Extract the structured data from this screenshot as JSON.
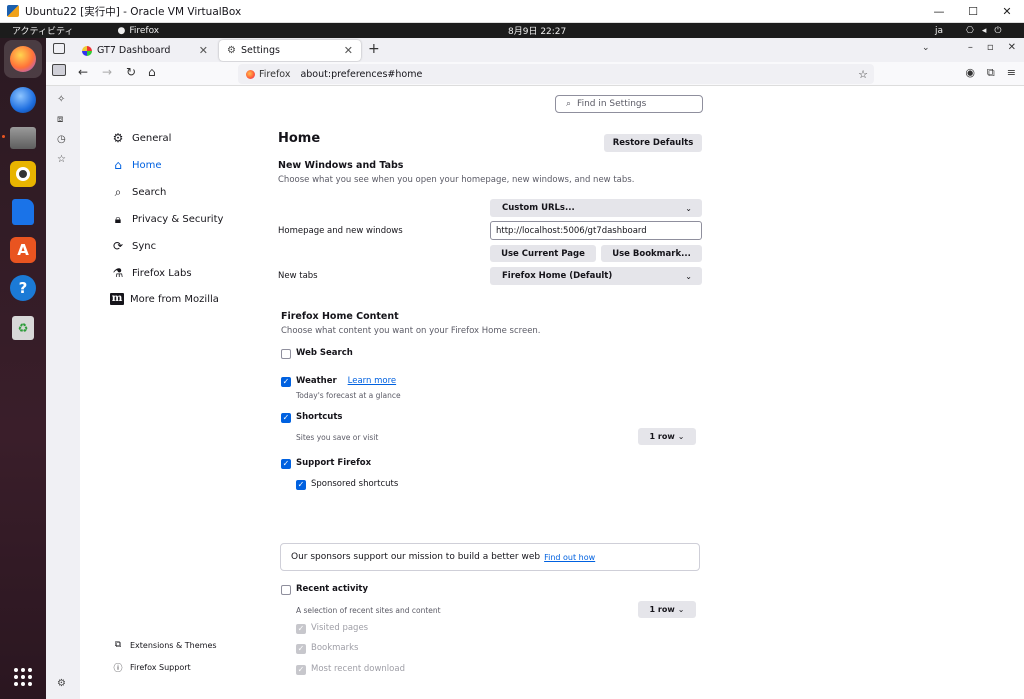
{
  "host_window": {
    "title": "Ubuntu22 [実行中] - Oracle VM VirtualBox",
    "controls": [
      "—",
      "☐",
      "✕"
    ]
  },
  "gnome": {
    "activities": "アクティビティ",
    "app_name": "Firefox",
    "clock": "8月9日  22:27",
    "lang": "ja"
  },
  "tabs": [
    {
      "label": "GT7 Dashboard",
      "active": false
    },
    {
      "label": "Settings",
      "active": true
    }
  ],
  "url": {
    "identity": "Firefox",
    "address": "about:preferences#home"
  },
  "search_placeholder": "Find in Settings",
  "categories": [
    {
      "label": "General",
      "icon": "gear-icon"
    },
    {
      "label": "Home",
      "icon": "home-icon",
      "selected": true
    },
    {
      "label": "Search",
      "icon": "search-icon"
    },
    {
      "label": "Privacy & Security",
      "icon": "lock-icon"
    },
    {
      "label": "Sync",
      "icon": "sync-icon"
    },
    {
      "label": "Firefox Labs",
      "icon": "flask-icon"
    },
    {
      "label": "More from Mozilla",
      "icon": "mozilla-icon"
    }
  ],
  "footer_links": {
    "extensions": "Extensions & Themes",
    "support": "Firefox Support"
  },
  "home": {
    "title": "Home",
    "restore_defaults": "Restore Defaults",
    "new_windows_title": "New Windows and Tabs",
    "new_windows_desc": "Choose what you see when you open your homepage, new windows, and new tabs.",
    "homepage_label": "Homepage and new windows",
    "homepage_select": "Custom URLs...",
    "homepage_url": "http://localhost:5006/gt7dashboard",
    "use_current_page": "Use Current Page",
    "use_bookmark": "Use Bookmark...",
    "new_tabs_label": "New tabs",
    "new_tabs_select": "Firefox Home (Default)",
    "content_title": "Firefox Home Content",
    "content_desc": "Choose what content you want on your Firefox Home screen.",
    "web_search": "Web Search",
    "weather": "Weather",
    "weather_learn_more": "Learn more",
    "weather_sub": "Today's forecast at a glance",
    "shortcuts": "Shortcuts",
    "shortcuts_sub": "Sites you save or visit",
    "shortcuts_rows": "1 row",
    "support_firefox": "Support Firefox",
    "sponsored_shortcuts": "Sponsored shortcuts",
    "sponsor_text": "Our sponsors support our mission to build a better web",
    "sponsor_link": "Find out how",
    "recent_activity": "Recent activity",
    "recent_sub": "A selection of recent sites and content",
    "recent_rows": "1 row",
    "visited_pages": "Visited pages",
    "bookmarks": "Bookmarks",
    "most_recent_download": "Most recent download"
  },
  "checkbox_states": {
    "web_search": false,
    "weather": true,
    "shortcuts": true,
    "support_firefox": true,
    "sponsored_shortcuts": true,
    "recent_activity": false,
    "visited_pages": true,
    "bookmarks": true,
    "most_recent_download": true
  },
  "colors": {
    "accent": "#0061e0",
    "dock_top": "#2b1a22",
    "ubuntu_orange": "#e95420"
  }
}
